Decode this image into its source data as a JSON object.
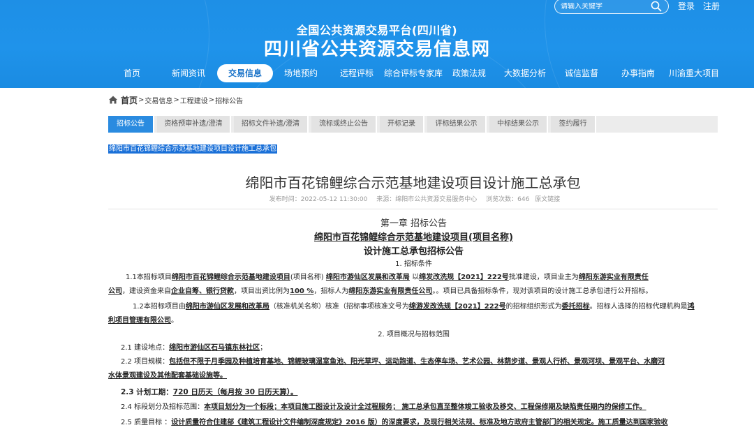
{
  "header": {
    "search_placeholder": "请输入关键字",
    "login": "登录",
    "register": "注册",
    "subtitle": "全国公共资源交易平台(四川省)",
    "title": "四川省公共资源交易信息网"
  },
  "nav": [
    {
      "label": "首页"
    },
    {
      "label": "新闻资讯"
    },
    {
      "label": "交易信息"
    },
    {
      "label": "场地预约"
    },
    {
      "label": "远程评标"
    },
    {
      "label": "综合评标专家库"
    },
    {
      "label": "政策法规"
    },
    {
      "label": "大数据分析"
    },
    {
      "label": "诚信监督"
    },
    {
      "label": "办事指南"
    },
    {
      "label": "川渝重大项目"
    }
  ],
  "breadcrumb": {
    "home": "首页",
    "items": [
      "交易信息",
      "工程建设",
      "招标公告"
    ]
  },
  "tabs": [
    {
      "label": "招标公告"
    },
    {
      "label": "资格预审补遗/澄清"
    },
    {
      "label": "招标文件补遗/澄清"
    },
    {
      "label": "流标或终止公告"
    },
    {
      "label": "开标记录"
    },
    {
      "label": "评标结果公示"
    },
    {
      "label": "中标结果公示"
    },
    {
      "label": "签约履行"
    }
  ],
  "selected_title": "绵阳市百花锦鲤综合示范基地建设项目设计施工总承包",
  "article": {
    "title": "绵阳市百花锦鲤综合示范基地建设项目设计施工总承包",
    "publish_time": "发布时间：2022-05-12 11:30:00",
    "source": "来源：绵阳市公共资源交易服务中心",
    "views": "浏览次数：646",
    "original_link": "原文链接"
  },
  "doc": {
    "chapter": "第一章  招标公告",
    "heading1": "绵阳市百花锦鲤综合示范基地建设项目(项目名称)",
    "heading2": "设计施工总承包招标公告",
    "sec1": "1. 招标条件",
    "p1_line1": {
      "a": "1.1本招标项目",
      "b": "绵阳市百花锦鲤综合示范基地建设项目",
      "c": "(项目名称)",
      "d": "绵阳市游仙区发展和改革局",
      "e": "以",
      "f": "绵发改洗规【2021】222号",
      "g": "批准建设，项目业主为",
      "h": "绵阳东游实业有限责任"
    },
    "p1_line2": {
      "a": "公司",
      "b": "，建设资金来自",
      "c": "企业自筹、银行贷款",
      "d": "，项目出资比例为",
      "e": "100 %",
      "f": "，招标人为",
      "g": "绵阳东游实业有限责任公司",
      "h": "。。项目已具备招标条件，现对该项目的设计施工总承包进行公开招标。"
    },
    "p2_line1": {
      "a": "1.2本招标项目由",
      "b": "绵阳市游仙区发展和改革局",
      "c": "（核准机关名称）核准（招标事项核准文号为",
      "d": "绵游发改洗规【2021】222号",
      "e": "的招标组织形式为",
      "f": "委托招标",
      "g": "。招标人选择的招标代理机构是",
      "h": "鸿"
    },
    "p2_line2": "利项目管理有限公司",
    "p2_line2_end": "。",
    "sec2": "2. 项目概况与招标范围",
    "p21": {
      "a": "2.1  建设地点：",
      "b": "绵阳市游仙区石马镇东林社区",
      "c": "；"
    },
    "p22_line1": {
      "a": "2.2  项目规模：",
      "b": "包括但不限于月季园及种植培育基地、锦鲤玻璃温室鱼池、阳光草坪、运动跑道、生态停车场、艺术公园、林荫步道、景观人行桥、景观河坝、景观平台、水磨河"
    },
    "p22_line2": "水体景观建设及其他配套基础设施等。",
    "p23": {
      "a": "2.3  计划工期：",
      "b": "720  日历天（每月按  30  日历天算）。"
    },
    "p24": {
      "a": "2.4  标段划分及招标范围：",
      "b": "本项目划分为一个标段；本项目施工图设计及设计全过程服务； 施工总承包直至整体竣工验收及移交、工程保修期及缺陷责任期内的保修工作。"
    },
    "p25": {
      "a": "2.5     质量目标 ：",
      "b": "设计质量符合住建部《建筑工程设计文件编制深度规定》2016 版）的深度要求，及现行相关法规、标准及地方政府主管部门的相关规定。施工质量达到国家验收"
    }
  },
  "colors": {
    "header_blue": "#1f93ea",
    "active_tab": "#2a8be0",
    "selection": "#1a70d8"
  },
  "icons": [
    "search-icon",
    "home-icon"
  ]
}
